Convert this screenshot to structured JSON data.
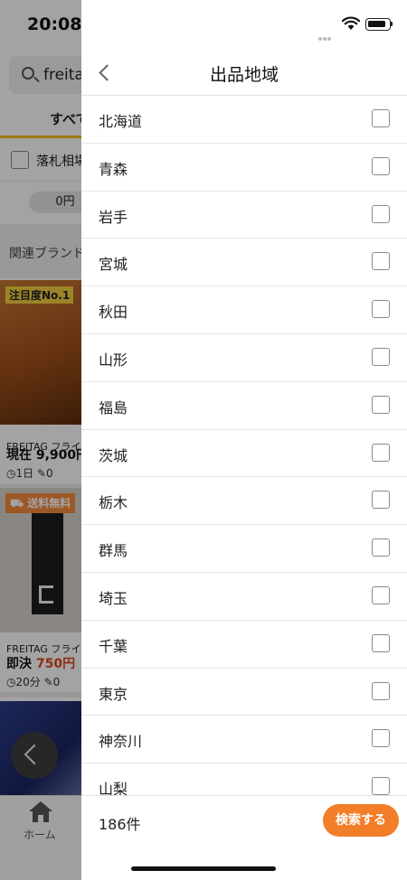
{
  "status_bar": {
    "time": "20:08"
  },
  "background": {
    "search_query": "freitag",
    "tab_all": "すべて",
    "filter_label": "落札相場",
    "price_pill": "0円",
    "related_brands": "関連ブランド",
    "items": [
      {
        "badge": "注目度No.1",
        "title": "FREITAG フライ",
        "price_prefix": "現在",
        "price": "9,900円",
        "time_left": "1日",
        "bids": "0"
      },
      {
        "badge": "送料無料",
        "title": "FREITAG フライ",
        "price_prefix": "即決",
        "price": "750円",
        "time_left": "20分",
        "bids": "0"
      }
    ],
    "tabbar_home": "ホーム"
  },
  "drawer": {
    "title": "出品地域",
    "regions": [
      "北海道",
      "青森",
      "岩手",
      "宮城",
      "秋田",
      "山形",
      "福島",
      "茨城",
      "栃木",
      "群馬",
      "埼玉",
      "千葉",
      "東京",
      "神奈川",
      "山梨"
    ],
    "result_count": "186件",
    "search_button": "検索する",
    "accent_color": "#f27e29"
  }
}
